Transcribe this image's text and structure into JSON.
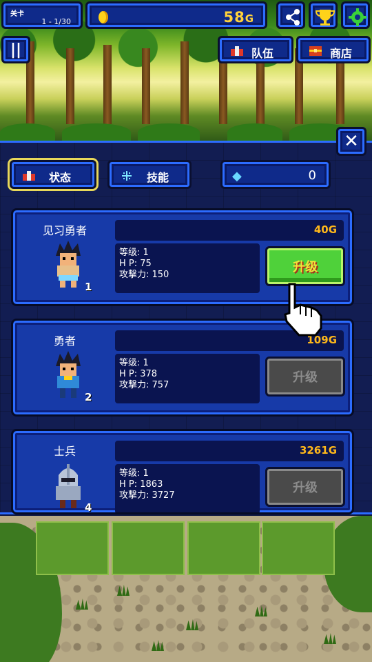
{
  "hud": {
    "stage_label": "关卡",
    "stage_progress": "1 - 1/30",
    "gold_amount": "58",
    "gold_unit": "G",
    "share_icon": "share-icon",
    "trophy_icon": "trophy-icon",
    "settings_icon": "gear-icon",
    "pause_glyph": "||",
    "team_label": "队伍",
    "shop_label": "商店"
  },
  "panel": {
    "close_glyph": "✕",
    "tabs": [
      {
        "label": "状态",
        "active": true
      },
      {
        "label": "技能",
        "active": false
      }
    ],
    "gems": "0"
  },
  "heroes": [
    {
      "name": "见习勇者",
      "cost": "40",
      "level": "等级: 1",
      "hp": "H P: 75",
      "atk": "攻撃力: 150",
      "rank": "1",
      "upgrade_label": "升级",
      "upgrade_enabled": true
    },
    {
      "name": "勇者",
      "cost": "109",
      "level": "等级: 1",
      "hp": "H P: 378",
      "atk": "攻撃力: 757",
      "rank": "2",
      "upgrade_label": "升级",
      "upgrade_enabled": false
    },
    {
      "name": "士兵",
      "cost": "3261",
      "level": "等级: 1",
      "hp": "H P: 1863",
      "atk": "攻撃力: 3727",
      "rank": "4",
      "upgrade_label": "升级",
      "upgrade_enabled": false
    }
  ],
  "gold_suffix": "G",
  "colors": {
    "panel_blue": "#173aa8",
    "frame_blue": "#2c6cff",
    "gold": "#ffb81a",
    "upgrade_green": "#4fd13a",
    "disabled_grey": "#4a4a4a"
  }
}
